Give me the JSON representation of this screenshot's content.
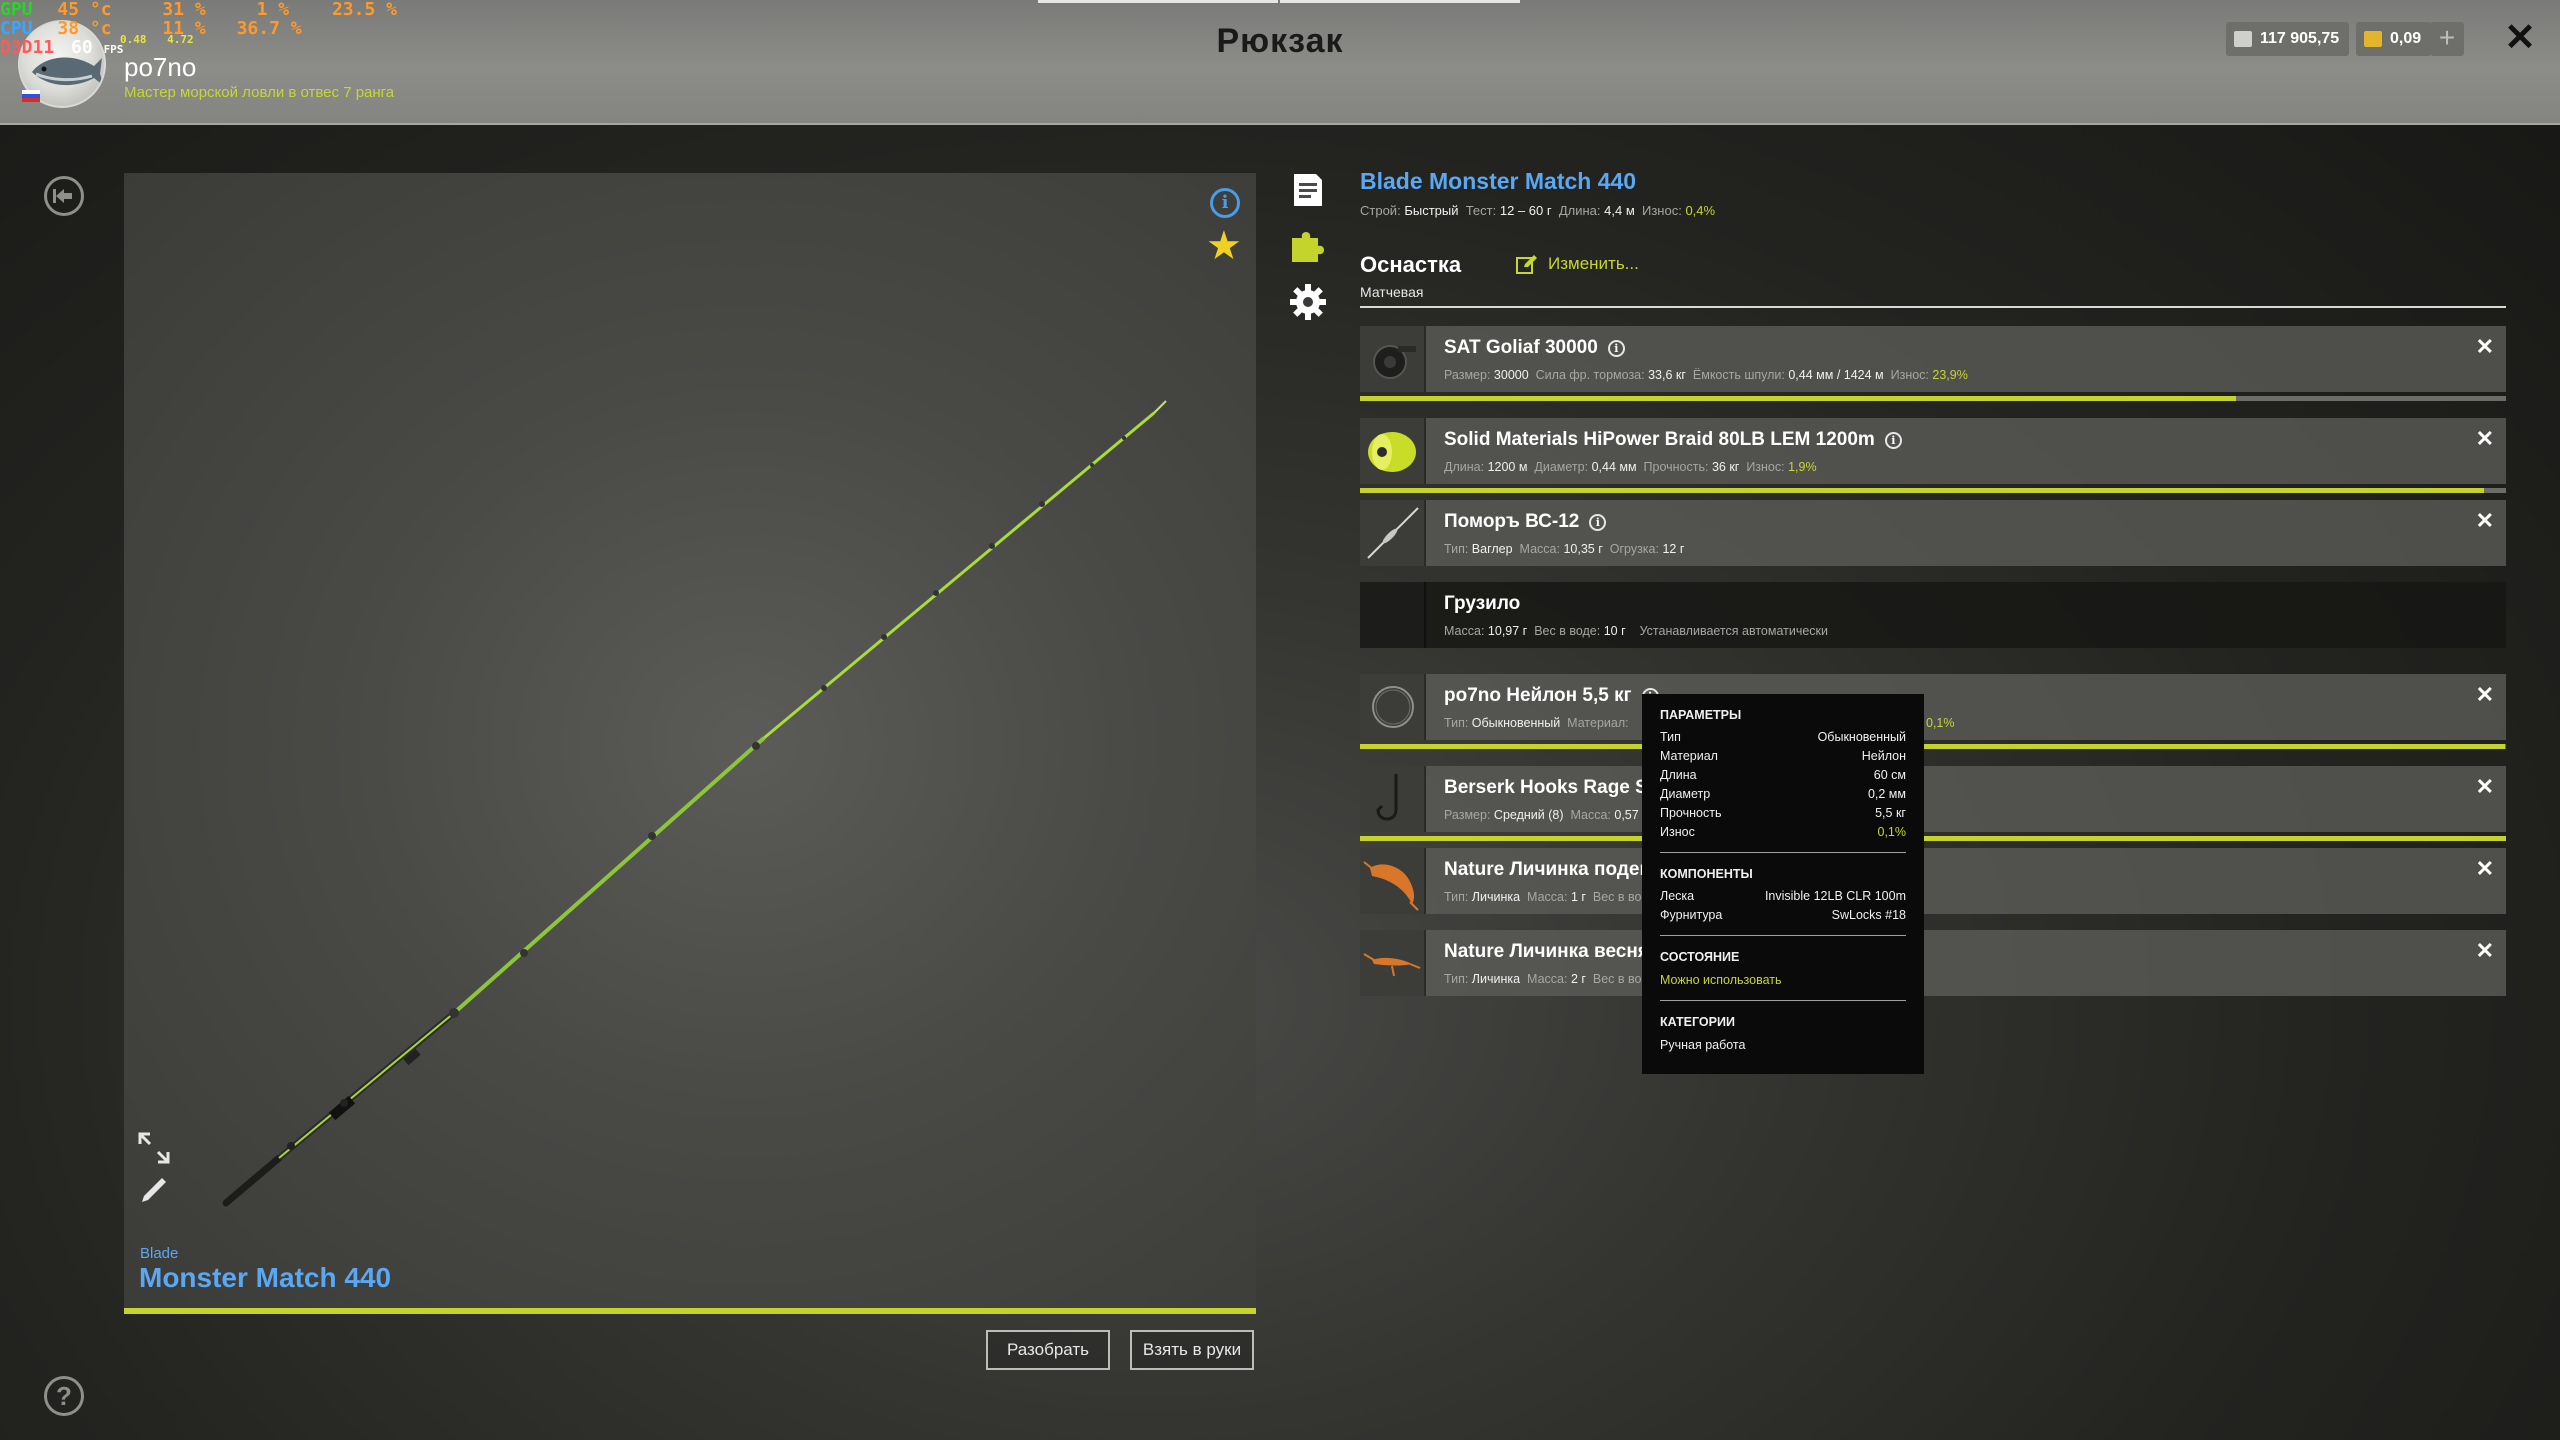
{
  "hud": {
    "gpu_label": "GPU",
    "gpu_temp": "45 °c",
    "gpu_load": "31 %",
    "gpu_extra": "1 %",
    "gpu_mem": "23.5 %",
    "cpu_label": "CPU",
    "cpu_temp": "38 °c",
    "cpu_load": "11 %",
    "cpu_extra": "36.7 %",
    "cpu_sub1": "0.48",
    "cpu_sub2": "4.72",
    "d3d_label": "D3D11",
    "fps_value": "60",
    "fps_unit": "FPS"
  },
  "header": {
    "title": "Рюкзак",
    "username": "po7no",
    "rank": "Мастер морской ловли в отвес 7 ранга",
    "silver": "117 905,75",
    "gold": "0,09",
    "plus": "+",
    "close": "✕"
  },
  "rod": {
    "brand": "Blade",
    "model": "Monster Match 440",
    "disassemble_label": "Разобрать",
    "equip_label": "Взять в руки"
  },
  "item": {
    "title": "Blade Monster Match 440",
    "stats": {
      "action_label": "Строй:",
      "action": "Быстрый",
      "test_label": "Тест:",
      "test": "12 – 60 г",
      "length_label": "Длина:",
      "length": "4,4 м",
      "wear_label": "Износ:",
      "wear": "0,4%"
    }
  },
  "rig": {
    "title": "Оснастка",
    "subtitle": "Матчевая",
    "change_label": "Изменить..."
  },
  "slots": [
    {
      "name": "SAT Goliaf 30000",
      "info": "i",
      "stats": [
        {
          "label": "Размер:",
          "value": "30000"
        },
        {
          "label": "Сила фр. тормоза:",
          "value": "33,6 кг"
        },
        {
          "label": "Ёмкость шпули:",
          "value": "0,44 мм / 1424 м"
        },
        {
          "label": "Износ:",
          "value": "23,9%",
          "green": true
        }
      ],
      "remove": "✕",
      "wear_fill": 0.764
    },
    {
      "name": "Solid Materials HiPower Braid 80LB LEM 1200m",
      "info": "i",
      "stats": [
        {
          "label": "Длина:",
          "value": "1200 м"
        },
        {
          "label": "Диаметр:",
          "value": "0,44 мм"
        },
        {
          "label": "Прочность:",
          "value": "36 кг"
        },
        {
          "label": "Износ:",
          "value": "1,9%",
          "green": true
        }
      ],
      "remove": "✕",
      "wear_fill": 0.981
    },
    {
      "name": "Поморъ ВС-12",
      "info": "i",
      "stats": [
        {
          "label": "Тип:",
          "value": "Ваглер"
        },
        {
          "label": "Масса:",
          "value": "10,35 г"
        },
        {
          "label": "Огрузка:",
          "value": "12 г"
        }
      ],
      "remove": "✕"
    },
    {
      "name": "Грузило",
      "stats": [
        {
          "label": "Масса:",
          "value": "10,97 г"
        },
        {
          "label": "Вес в воде:",
          "value": "10 г"
        },
        {
          "label": "",
          "value": "Устанавливается автоматически",
          "muted": true
        }
      ]
    },
    {
      "name": "po7no Нейлон 5,5 кг",
      "info": "i",
      "stats": [
        {
          "label": "Тип:",
          "value": "Обыкновенный"
        },
        {
          "label": "Материал:",
          "value": ""
        }
      ],
      "hidden_wear": "0,1%",
      "remove": "✕",
      "wear_fill": 0.999
    },
    {
      "name": "Berserk Hooks Rage Ser",
      "stats": [
        {
          "label": "Размер:",
          "value": "Средний (8)"
        },
        {
          "label": "Масса:",
          "value": "0,57"
        }
      ],
      "remove": "✕",
      "wear_fill": 1.0
    },
    {
      "name": "Nature Личинка поден",
      "stats": [
        {
          "label": "Тип:",
          "value": "Личинка"
        },
        {
          "label": "Масса:",
          "value": "1 г"
        },
        {
          "label": "Вес в во",
          "value": ""
        }
      ],
      "remove": "✕"
    },
    {
      "name": "Nature Личинка весня",
      "stats": [
        {
          "label": "Тип:",
          "value": "Личинка"
        },
        {
          "label": "Масса:",
          "value": "2 г"
        },
        {
          "label": "Вес в во",
          "value": ""
        }
      ],
      "remove": "✕"
    }
  ],
  "tooltip": {
    "params_title": "ПАРАМЕТРЫ",
    "params": [
      {
        "label": "Тип",
        "value": "Обыкновенный"
      },
      {
        "label": "Материал",
        "value": "Нейлон"
      },
      {
        "label": "Длина",
        "value": "60 см"
      },
      {
        "label": "Диаметр",
        "value": "0,2 мм"
      },
      {
        "label": "Прочность",
        "value": "5,5 кг"
      },
      {
        "label": "Износ",
        "value": "0,1%",
        "green": true
      }
    ],
    "components_title": "КОМПОНЕНТЫ",
    "components": [
      {
        "label": "Леска",
        "value": "Invisible 12LB CLR 100m"
      },
      {
        "label": "Фурнитура",
        "value": "SwLocks #18"
      }
    ],
    "state_title": "СОСТОЯНИЕ",
    "state": "Можно использовать",
    "categories_title": "КАТЕГОРИИ",
    "category": "Ручная работа"
  },
  "colors": {
    "accent_green": "#c4d42c",
    "title_blue": "#5aa7f2",
    "star": "#f0d020"
  }
}
